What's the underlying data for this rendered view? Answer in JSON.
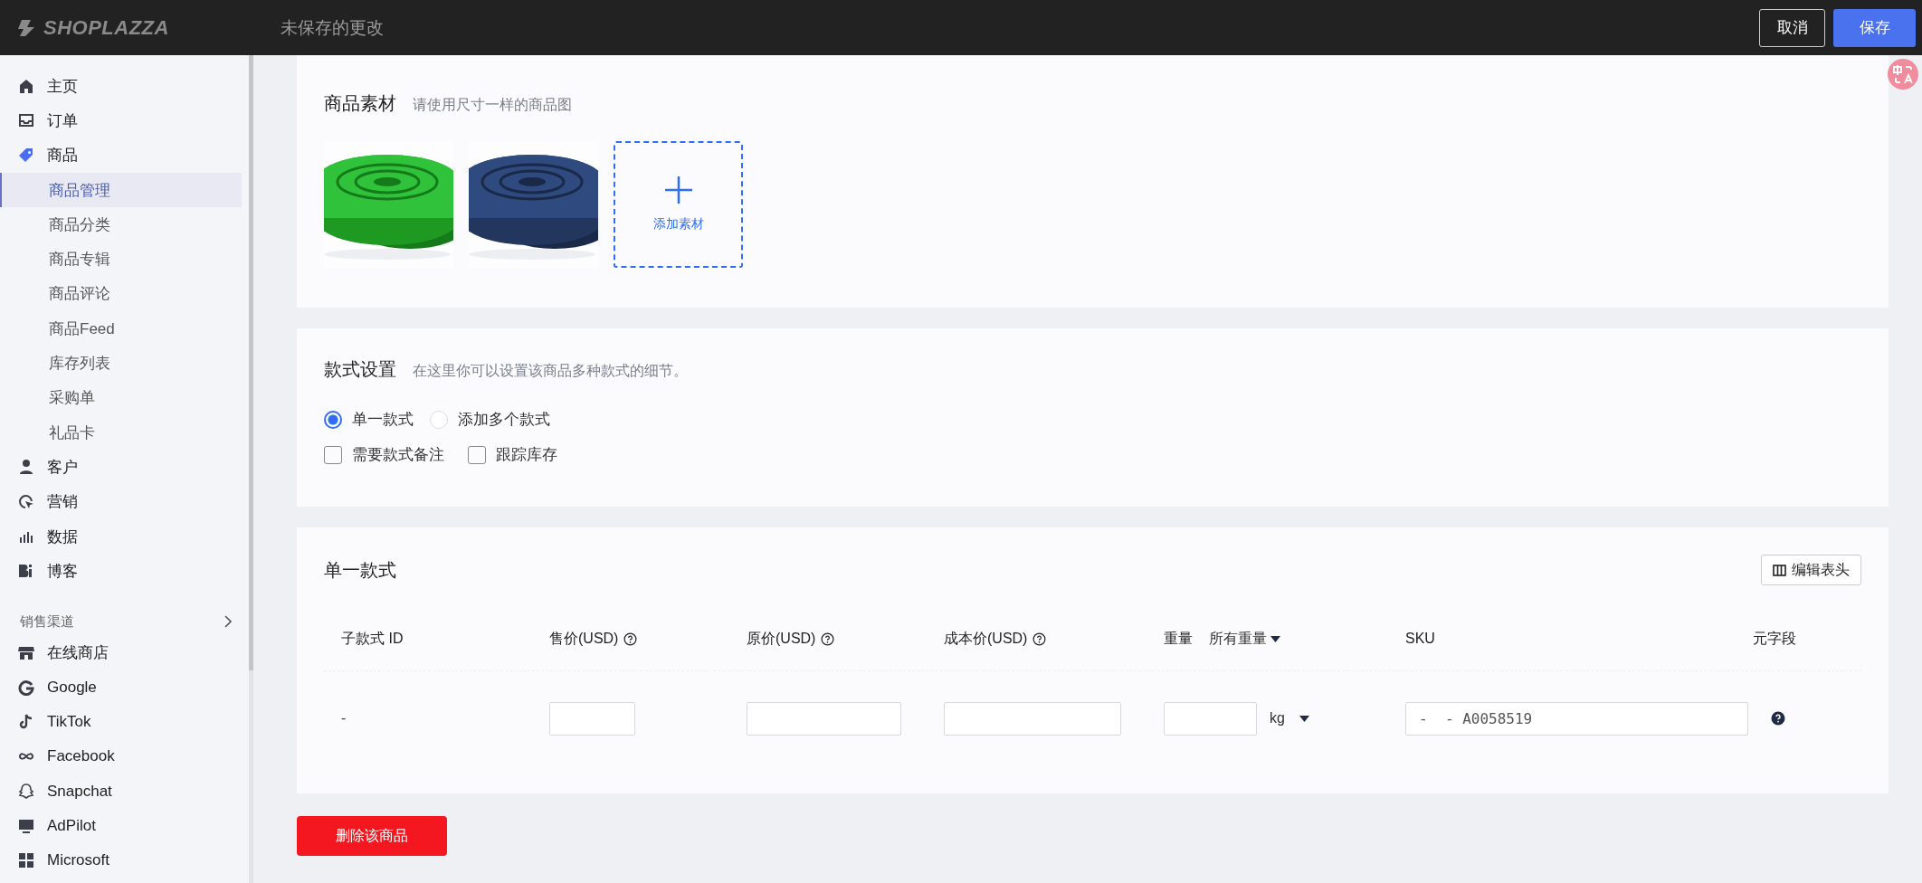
{
  "top_bar": {
    "logo": "SHOPLAZZA",
    "status": "未保存的更改",
    "buttons": [
      {
        "label": "取消",
        "kind": "secondary"
      },
      {
        "label": "保存",
        "kind": "primary"
      }
    ]
  },
  "sidebar": {
    "items": [
      {
        "label": "主页"
      },
      {
        "label": "订单"
      },
      {
        "label": "商品",
        "children": [
          {
            "label": "商品管理",
            "selected": true
          },
          {
            "label": "商品分类",
            "selected": false
          },
          {
            "label": "商品专辑",
            "selected": false
          },
          {
            "label": "商品评论",
            "selected": false
          },
          {
            "label": "商品Feed",
            "selected": false
          },
          {
            "label": "库存列表",
            "selected": false
          },
          {
            "label": "采购单",
            "selected": false
          },
          {
            "label": "礼品卡",
            "selected": false
          }
        ]
      },
      {
        "label": "客户"
      },
      {
        "label": "营销"
      },
      {
        "label": "数据"
      },
      {
        "label": "博客"
      }
    ],
    "section": {
      "title": "销售渠道",
      "channels": [
        {
          "label": "在线商店"
        },
        {
          "label": "Google"
        },
        {
          "label": "TikTok"
        },
        {
          "label": "Facebook"
        },
        {
          "label": "Snapchat"
        },
        {
          "label": "AdPilot"
        },
        {
          "label": "Microsoft"
        }
      ]
    }
  },
  "media": {
    "title": "商品素材",
    "hint": "请使用尺寸一样的商品图",
    "add_label": "添加素材"
  },
  "variants": {
    "title": "款式设置",
    "hint": "在这里你可以设置该商品多种款式的细节。",
    "options": [
      {
        "label": "单一款式",
        "selected": true
      },
      {
        "label": "添加多个款式",
        "selected": false
      }
    ],
    "checkboxes": [
      {
        "label": "需要款式备注",
        "checked": false
      },
      {
        "label": "跟踪库存",
        "checked": false
      }
    ]
  },
  "variant_table": {
    "title": "单一款式",
    "edit_button": "编辑表头",
    "columns": [
      {
        "label": "子款式 ID",
        "kind": "plain"
      },
      {
        "label": "售价(USD)",
        "kind": "help"
      },
      {
        "label": "原价(USD)",
        "kind": "help"
      },
      {
        "label": "成本价(USD)",
        "kind": "help"
      },
      {
        "label": "重量",
        "kind": "filter",
        "filter": "所有重量"
      },
      {
        "label": "SKU",
        "kind": "plain"
      },
      {
        "label": "元字段",
        "kind": "plain"
      }
    ],
    "row": [
      {
        "kind": "text",
        "value": "-"
      },
      {
        "kind": "input"
      },
      {
        "kind": "input"
      },
      {
        "kind": "input"
      },
      {
        "kind": "weight",
        "unit": "kg"
      },
      {
        "kind": "input",
        "value": "-  - A0058519"
      },
      {
        "kind": "help"
      }
    ]
  },
  "delete_button": "删除该商品"
}
